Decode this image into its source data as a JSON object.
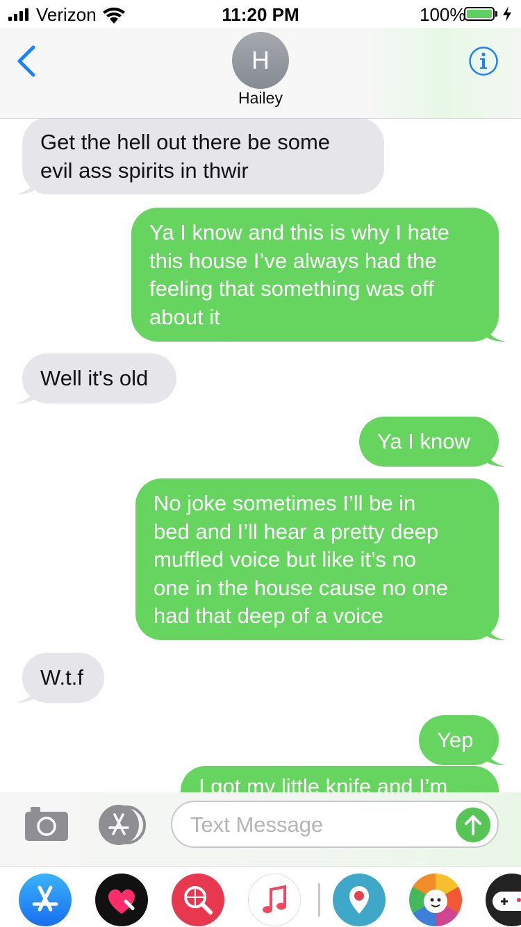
{
  "status_bar": {
    "carrier": "Verizon",
    "time": "11:20 PM",
    "battery_percent": "100%",
    "signal_bars": 4,
    "battery_level": 1.0,
    "charging": true
  },
  "header": {
    "avatar_initial": "H",
    "contact_name": "Hailey",
    "back_icon": "chevron-left-icon",
    "info_icon": "info-circle-icon",
    "accent_color": "#1a82fb"
  },
  "messages": [
    {
      "direction": "incoming",
      "lines": [
        "Get the hell out there be some",
        "evil ass spirits in thwir"
      ]
    },
    {
      "direction": "outgoing",
      "lines": [
        "Ya I know and this is why I hate",
        "this house I’ve always had the",
        "feeling that something was off",
        "about it"
      ]
    },
    {
      "direction": "incoming",
      "lines": [
        "Well it's old"
      ]
    },
    {
      "direction": "outgoing",
      "lines": [
        "Ya I know"
      ]
    },
    {
      "direction": "outgoing",
      "lines": [
        "No joke sometimes I’ll be in",
        "bed and I’ll hear a pretty deep",
        "muffled voice but like it’s no",
        "one in the house cause no one",
        "had that deep of a voice"
      ]
    },
    {
      "direction": "incoming",
      "lines": [
        "W.t.f"
      ]
    },
    {
      "direction": "outgoing",
      "lines": [
        "Yep"
      ]
    },
    {
      "direction": "outgoing",
      "lines": [
        "I got my little knife and I’m"
      ]
    }
  ],
  "colors": {
    "incoming_bubble": "#e5e5ea",
    "outgoing_bubble": "#66d560",
    "send_button": "#55c655"
  },
  "compose": {
    "placeholder": "Text Message",
    "value": "",
    "camera_icon": "camera-icon",
    "apps_icon": "app-store-icon",
    "send_icon": "arrow-up-icon"
  },
  "app_drawer": [
    {
      "name": "app-store-icon"
    },
    {
      "name": "digital-touch-heart-icon"
    },
    {
      "name": "web-images-search-icon"
    },
    {
      "name": "music-note-icon"
    },
    {
      "name": "periscope-icon"
    },
    {
      "name": "trivia-crack-icon"
    },
    {
      "name": "game-controller-icon"
    }
  ]
}
